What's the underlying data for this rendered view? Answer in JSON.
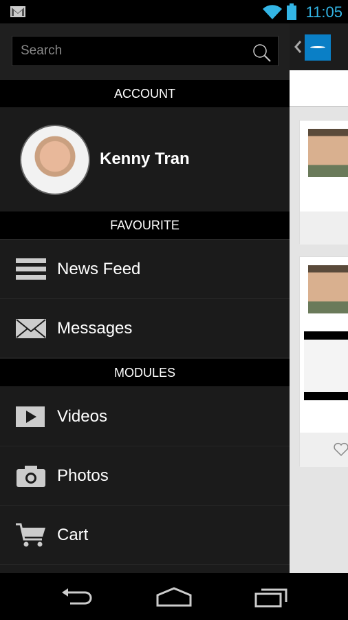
{
  "status_bar": {
    "time": "11:05",
    "icons": [
      "gmail-icon",
      "wifi-icon",
      "battery-icon"
    ],
    "accent": "#33b5e5"
  },
  "drawer": {
    "search": {
      "placeholder": "Search"
    },
    "sections": {
      "account": "ACCOUNT",
      "favourite": "FAVOURITE",
      "modules": "MODULES"
    },
    "profile": {
      "name": "Kenny Tran"
    },
    "favourite_items": [
      {
        "label": "News Feed",
        "icon": "menu-icon"
      },
      {
        "label": "Messages",
        "icon": "envelope-icon"
      }
    ],
    "module_items": [
      {
        "label": "Videos",
        "icon": "play-icon"
      },
      {
        "label": "Photos",
        "icon": "camera-icon"
      },
      {
        "label": "Cart",
        "icon": "cart-icon"
      }
    ]
  },
  "main": {
    "logo_brand_color": "#0a7fc6"
  },
  "nav_bar": {
    "buttons": [
      "back",
      "home",
      "recents"
    ]
  }
}
